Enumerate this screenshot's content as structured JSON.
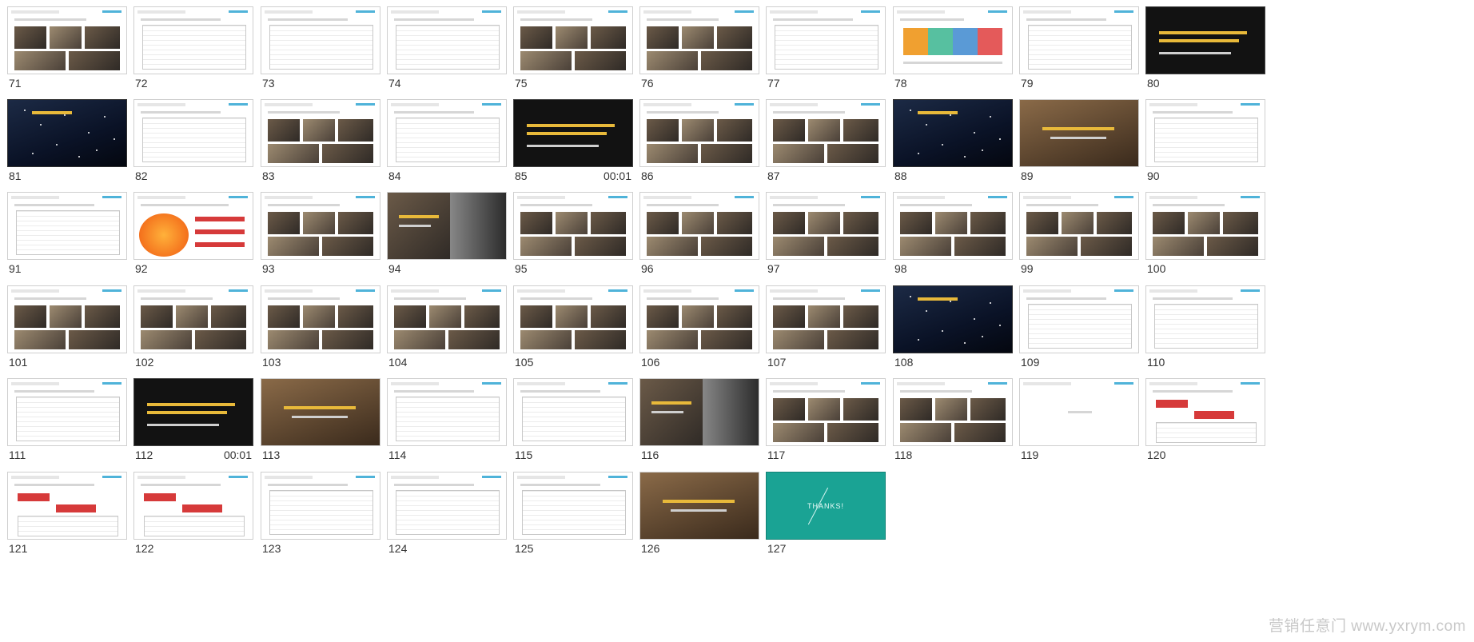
{
  "slides": [
    {
      "n": "71",
      "style": "mixed"
    },
    {
      "n": "72",
      "style": "table"
    },
    {
      "n": "73",
      "style": "table"
    },
    {
      "n": "74",
      "style": "table"
    },
    {
      "n": "75",
      "style": "mixed"
    },
    {
      "n": "76",
      "style": "mixed"
    },
    {
      "n": "77",
      "style": "table"
    },
    {
      "n": "78",
      "style": "bars"
    },
    {
      "n": "79",
      "style": "table"
    },
    {
      "n": "80",
      "style": "dark"
    },
    {
      "n": "81",
      "style": "night"
    },
    {
      "n": "82",
      "style": "table"
    },
    {
      "n": "83",
      "style": "mixed"
    },
    {
      "n": "84",
      "style": "table"
    },
    {
      "n": "85",
      "style": "dark",
      "duration": "00:01"
    },
    {
      "n": "86",
      "style": "mixed"
    },
    {
      "n": "87",
      "style": "mixed"
    },
    {
      "n": "88",
      "style": "night"
    },
    {
      "n": "89",
      "style": "photo"
    },
    {
      "n": "90",
      "style": "table"
    },
    {
      "n": "91",
      "style": "table"
    },
    {
      "n": "92",
      "style": "orange"
    },
    {
      "n": "93",
      "style": "mixed"
    },
    {
      "n": "94",
      "style": "bwphoto"
    },
    {
      "n": "95",
      "style": "mixed"
    },
    {
      "n": "96",
      "style": "mixed"
    },
    {
      "n": "97",
      "style": "mixed"
    },
    {
      "n": "98",
      "style": "mixed"
    },
    {
      "n": "99",
      "style": "mixed"
    },
    {
      "n": "100",
      "style": "mixed"
    },
    {
      "n": "101",
      "style": "mixed"
    },
    {
      "n": "102",
      "style": "mixed"
    },
    {
      "n": "103",
      "style": "mixed"
    },
    {
      "n": "104",
      "style": "mixed"
    },
    {
      "n": "105",
      "style": "mixed"
    },
    {
      "n": "106",
      "style": "mixed"
    },
    {
      "n": "107",
      "style": "mixed"
    },
    {
      "n": "108",
      "style": "night"
    },
    {
      "n": "109",
      "style": "table"
    },
    {
      "n": "110",
      "style": "table"
    },
    {
      "n": "111",
      "style": "table"
    },
    {
      "n": "112",
      "style": "dark",
      "duration": "00:01"
    },
    {
      "n": "113",
      "style": "photo"
    },
    {
      "n": "114",
      "style": "table"
    },
    {
      "n": "115",
      "style": "table"
    },
    {
      "n": "116",
      "style": "bwphoto"
    },
    {
      "n": "117",
      "style": "mixed"
    },
    {
      "n": "118",
      "style": "mixed"
    },
    {
      "n": "119",
      "style": "plain"
    },
    {
      "n": "120",
      "style": "red"
    },
    {
      "n": "121",
      "style": "red"
    },
    {
      "n": "122",
      "style": "red"
    },
    {
      "n": "123",
      "style": "table"
    },
    {
      "n": "124",
      "style": "table"
    },
    {
      "n": "125",
      "style": "table"
    },
    {
      "n": "126",
      "style": "photo"
    },
    {
      "n": "127",
      "style": "teal",
      "text": "THANKS!"
    }
  ],
  "watermark": "营销任意门 www.yxrym.com",
  "colors": {
    "accent": "#4fb3d9",
    "gold": "#e8b93a",
    "teal": "#1aa394",
    "red": "#d63a3a"
  }
}
